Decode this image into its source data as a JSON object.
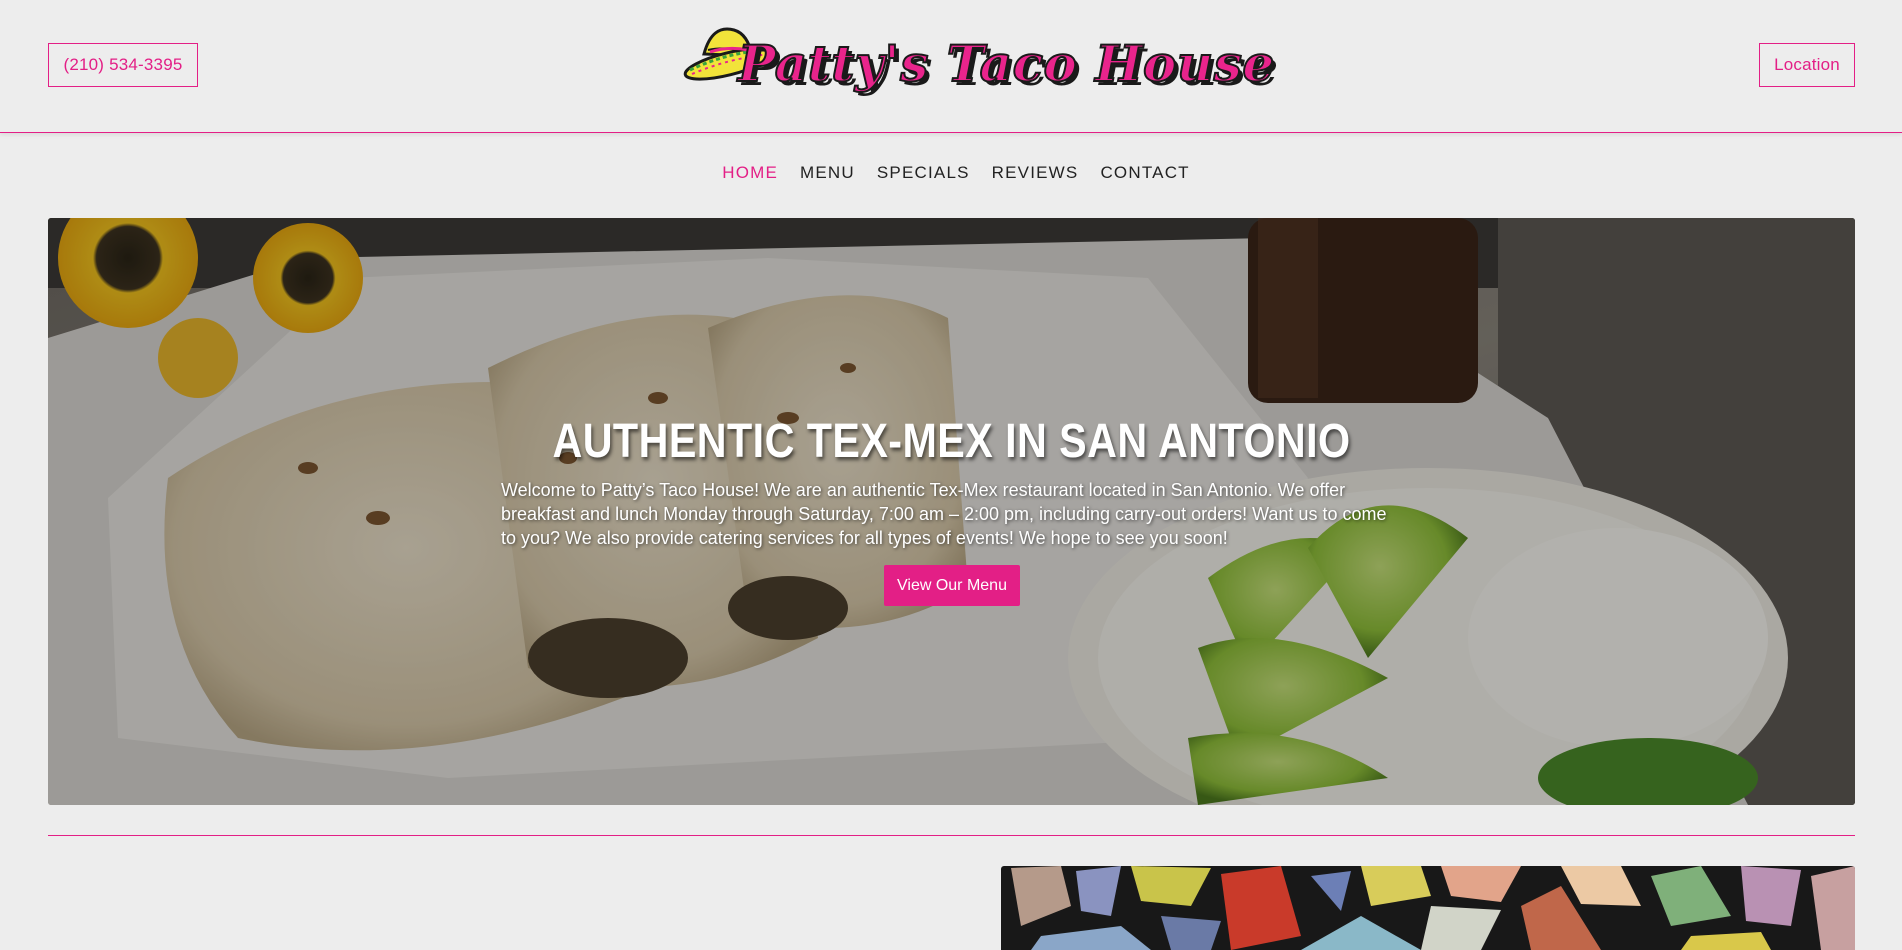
{
  "header": {
    "phone_label": "(210) 534-3395",
    "location_label": "Location",
    "logo_text": "Patty's Taco House"
  },
  "nav": {
    "items": [
      {
        "label": "HOME",
        "active": true
      },
      {
        "label": "MENU",
        "active": false
      },
      {
        "label": "SPECIALS",
        "active": false
      },
      {
        "label": "REVIEWS",
        "active": false
      },
      {
        "label": "CONTACT",
        "active": false
      }
    ]
  },
  "hero": {
    "title": "AUTHENTIC TEX-MEX IN SAN ANTONIO",
    "description": "Welcome to Patty’s Taco House! We are an authentic Tex-Mex restaurant located in San Antonio. We offer breakfast and lunch Monday through Saturday, 7:00 am – 2:00 pm, including carry-out orders! Want us to come to you? We also provide catering services for all types of events! We hope to see you soon!",
    "button_label": "View Our Menu"
  },
  "colors": {
    "accent": "#e31f86",
    "background": "#ededed",
    "text": "#222222"
  },
  "icons": {
    "logo_icon": "sombrero-icon"
  }
}
